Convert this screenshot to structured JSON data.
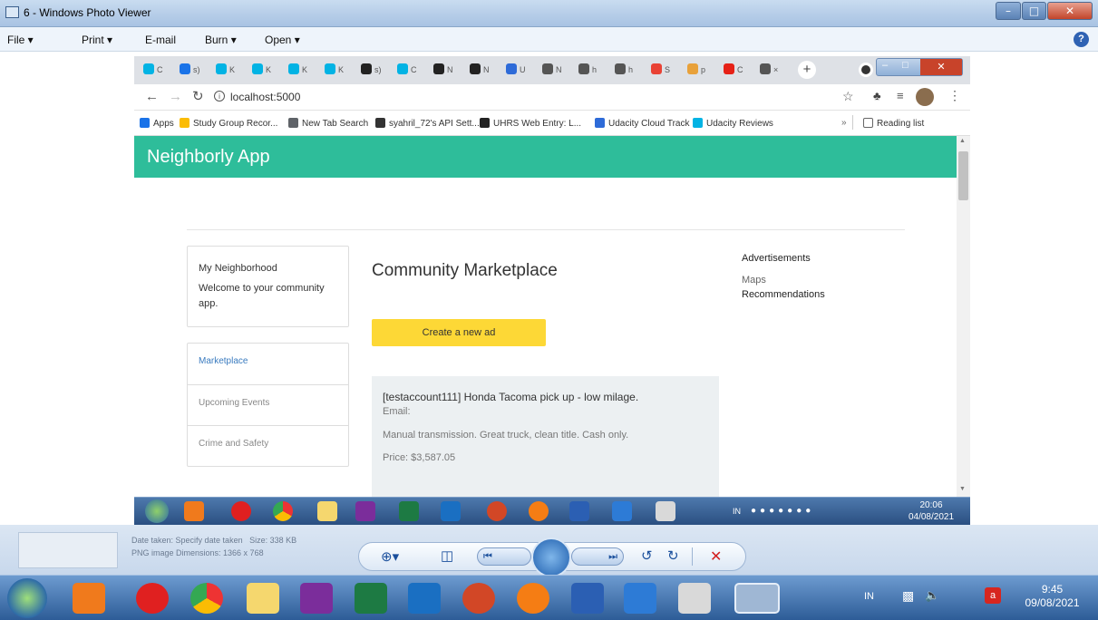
{
  "viewer": {
    "title": "6 - Windows Photo Viewer",
    "menu": {
      "file": "File",
      "print": "Print",
      "email": "E-mail",
      "burn": "Burn",
      "open": "Open"
    },
    "file_info": {
      "date": "Date taken: Specify date taken",
      "size": "Size: 338 KB",
      "type": "PNG image  Dimensions: 1366 x 768"
    }
  },
  "browser": {
    "tabs": [
      {
        "label": "C",
        "icon": "udacity-icon",
        "color": "#02b3e4"
      },
      {
        "label": "s)",
        "icon": "drive-icon",
        "color": "#1a73e8"
      },
      {
        "label": "K",
        "icon": "udacity-icon",
        "color": "#02b3e4"
      },
      {
        "label": "K",
        "icon": "udacity-icon",
        "color": "#02b3e4"
      },
      {
        "label": "K",
        "icon": "udacity-icon",
        "color": "#02b3e4"
      },
      {
        "label": "K",
        "icon": "udacity-icon",
        "color": "#02b3e4"
      },
      {
        "label": "s)",
        "icon": "github-icon",
        "color": "#222"
      },
      {
        "label": "C",
        "icon": "udacity-icon",
        "color": "#02b3e4"
      },
      {
        "label": "N",
        "icon": "github-icon",
        "color": "#222"
      },
      {
        "label": "N",
        "icon": "github-icon",
        "color": "#222"
      },
      {
        "label": "U",
        "icon": "doc-icon",
        "color": "#2e6bd8"
      },
      {
        "label": "N",
        "icon": "globe-icon",
        "color": "#555"
      },
      {
        "label": "h",
        "icon": "globe-icon",
        "color": "#555"
      },
      {
        "label": "h",
        "icon": "globe-icon",
        "color": "#555"
      },
      {
        "label": "S",
        "icon": "apps-icon",
        "color": "#e94235"
      },
      {
        "label": "p",
        "icon": "pencil-icon",
        "color": "#e8a13a"
      },
      {
        "label": "C",
        "icon": "youtube-icon",
        "color": "#e62117"
      },
      {
        "label": "×",
        "icon": "globe-icon",
        "color": "#555"
      }
    ],
    "url": "localhost:5000",
    "bookmarks": [
      {
        "label": "Apps",
        "color": "#1a73e8"
      },
      {
        "label": "Study Group Recor...",
        "color": "#fbbc04"
      },
      {
        "label": "New Tab Search",
        "color": "#5f6368"
      },
      {
        "label": "syahril_72's API Sett...",
        "color": "#333"
      },
      {
        "label": "UHRS Web Entry: L...",
        "color": "#222"
      },
      {
        "label": "Udacity Cloud Track",
        "color": "#2e6bd8"
      },
      {
        "label": "Udacity Reviews",
        "color": "#02b3e4"
      }
    ],
    "reading_list": "Reading list",
    "more": "»"
  },
  "page": {
    "brand": "Neighborly App",
    "sidebar": {
      "heading": "My Neighborhood",
      "welcome": "Welcome to your community app.",
      "items": [
        "Marketplace",
        "Upcoming Events",
        "Crime and Safety"
      ]
    },
    "main": {
      "title": "Community Marketplace",
      "create_button": "Create a new ad",
      "ad": {
        "title": "[testaccount111] Honda Tacoma pick up - low milage.",
        "email": "Email:",
        "description": "Manual transmission. Great truck, clean title. Cash only.",
        "price": "Price: $3,587.05"
      }
    },
    "right": {
      "heading": "Advertisements",
      "links": [
        "Maps",
        "Recommendations"
      ]
    }
  },
  "inner_taskbar": {
    "lang": "IN",
    "time": "20:06",
    "date": "04/08/2021"
  },
  "outer_taskbar": {
    "lang": "IN",
    "time": "9:45",
    "date": "09/08/2021"
  },
  "colors": {
    "navbar": "#2ebd9a",
    "create_button": "#fdd836",
    "ad_card": "#ecf0f2"
  }
}
